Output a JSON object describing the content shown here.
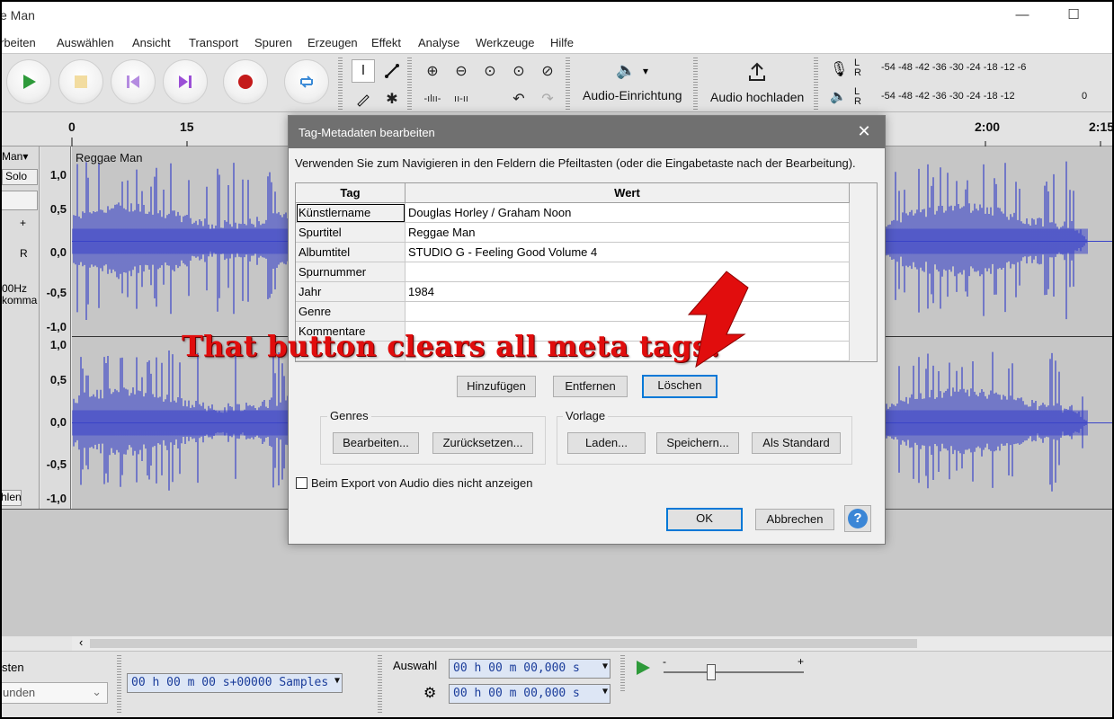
{
  "window": {
    "title_fragment": "e Man",
    "minimize": "—",
    "maximize": "☐"
  },
  "menu": [
    "rbeiten",
    "Auswählen",
    "Ansicht",
    "Transport",
    "Spuren",
    "Erzeugen",
    "Effekt",
    "Analyse",
    "Werkzeuge",
    "Hilfe"
  ],
  "toolbar": {
    "audio_setup": "Audio-Einrichtung",
    "audio_setup_arrow": "▾",
    "share_audio": "Audio hochladen",
    "meter_rec": {
      "l": "L",
      "r": "R",
      "scale": "-54  -48  -42  -36  -30  -24  -18  -12   -6"
    },
    "meter_play": {
      "l": "L",
      "r": "R",
      "scale": "-54  -48  -42  -36  -30  -24  -18  -12",
      "end": "0"
    }
  },
  "ruler": {
    "labels": [
      "0",
      "15",
      "2:00",
      "2:15"
    ]
  },
  "track": {
    "menu_label": "Man▾",
    "solo": "Solo",
    "gain_plus": "+",
    "pan_r": "R",
    "rate": "00Hz",
    "format": "komma",
    "collapse": "hlen",
    "name": "Reggae Man",
    "scale_top": [
      "1,0",
      "0,5",
      "0,0",
      "-0,5",
      "-1,0"
    ],
    "scale_bottom": [
      "1,0",
      "0,5",
      "0,0",
      "-0,5",
      "-1,0"
    ]
  },
  "bottombar": {
    "snap_label": "sten",
    "snap_value": "unden",
    "audio_position": "00 h 00 m 00 s+00000 Samples",
    "selection_label": "Auswahl",
    "sel_start": "00 h 00 m 00,000 s",
    "sel_end": "00 h 00 m 00,000 s",
    "speed_minus": "-",
    "speed_plus": "+"
  },
  "dialog": {
    "title": "Tag-Metadaten bearbeiten",
    "close": "✕",
    "instructions": "Verwenden Sie zum Navigieren in den Feldern die Pfeiltasten (oder die Eingabetaste nach der Bearbeitung).",
    "col_tag": "Tag",
    "col_value": "Wert",
    "rows": [
      {
        "tag": "Künstlername",
        "value": "Douglas Horley / Graham Noon"
      },
      {
        "tag": "Spurtitel",
        "value": "Reggae Man"
      },
      {
        "tag": "Albumtitel",
        "value": "STUDIO G - Feeling Good Volume 4"
      },
      {
        "tag": "Spurnummer",
        "value": ""
      },
      {
        "tag": "Jahr",
        "value": "1984"
      },
      {
        "tag": "Genre",
        "value": ""
      },
      {
        "tag": "Kommentare",
        "value": ""
      }
    ],
    "add": "Hinzufügen",
    "remove": "Entfernen",
    "clear": "Löschen",
    "genres_label": "Genres",
    "genres_edit": "Bearbeiten...",
    "genres_reset": "Zurücksetzen...",
    "template_label": "Vorlage",
    "template_load": "Laden...",
    "template_save": "Speichern...",
    "template_default": "Als Standard",
    "dont_show": "Beim Export von Audio dies nicht anzeigen",
    "ok": "OK",
    "cancel": "Abbrechen",
    "help": "?"
  },
  "annotation": {
    "text": "That button clears all meta tags!",
    "color": "#e10d0d"
  },
  "colors": {
    "waveform": "#3a44c8",
    "waveform_bg": "#c6c6c6",
    "dialog_title": "#707070",
    "focus": "#0078d7"
  }
}
